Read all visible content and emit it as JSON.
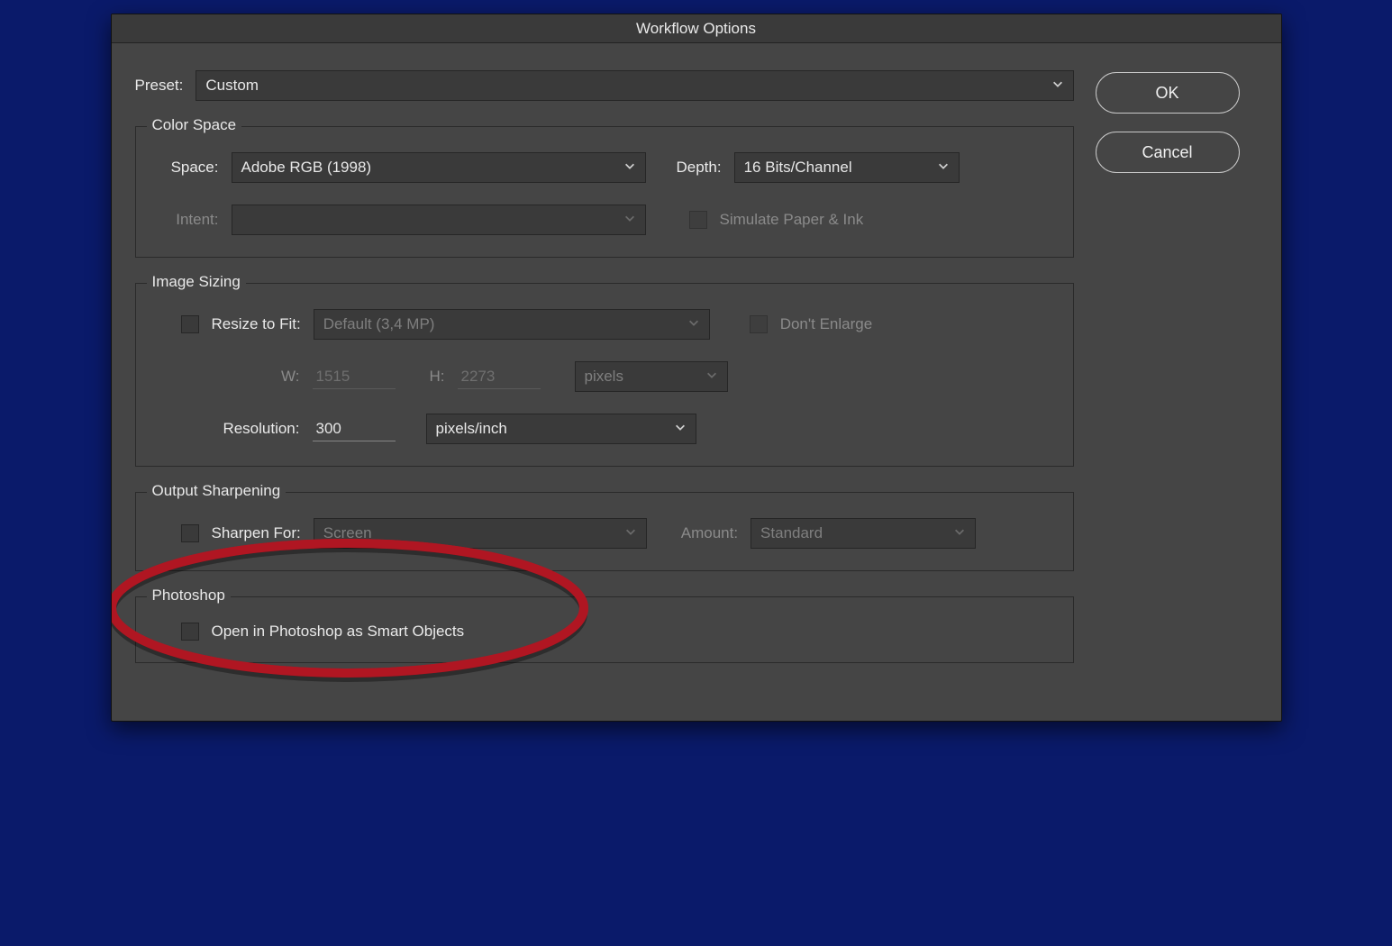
{
  "title": "Workflow Options",
  "buttons": {
    "ok": "OK",
    "cancel": "Cancel"
  },
  "preset": {
    "label": "Preset:",
    "value": "Custom"
  },
  "colorSpace": {
    "legend": "Color Space",
    "spaceLabel": "Space:",
    "spaceValue": "Adobe RGB (1998)",
    "depthLabel": "Depth:",
    "depthValue": "16 Bits/Channel",
    "intentLabel": "Intent:",
    "intentValue": "",
    "simulateLabel": "Simulate Paper & Ink"
  },
  "imageSizing": {
    "legend": "Image Sizing",
    "resizeLabel": "Resize to Fit:",
    "resizeValue": "Default  (3,4 MP)",
    "dontEnlarge": "Don't Enlarge",
    "wLabel": "W:",
    "wValue": "1515",
    "hLabel": "H:",
    "hValue": "2273",
    "unit": "pixels",
    "resLabel": "Resolution:",
    "resValue": "300",
    "resUnit": "pixels/inch"
  },
  "sharpen": {
    "legend": "Output Sharpening",
    "sharpenLabel": "Sharpen For:",
    "sharpenValue": "Screen",
    "amountLabel": "Amount:",
    "amountValue": "Standard"
  },
  "photoshop": {
    "legend": "Photoshop",
    "smartLabel": "Open in Photoshop as Smart Objects"
  }
}
